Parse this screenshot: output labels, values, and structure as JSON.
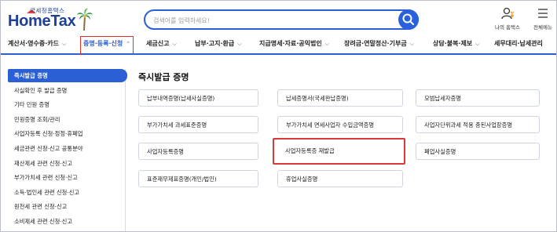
{
  "header": {
    "logo_small": "국세청홈택스",
    "logo_main": "HomeTax",
    "search_placeholder": "검색어를 입력하세요!",
    "my_hometax_label": "나의 홈택스",
    "full_menu_label": "전체메뉴"
  },
  "nav": {
    "items": [
      {
        "label": "계산서·영수증·카드",
        "active": false
      },
      {
        "label": "증명·등록·신청",
        "active": true
      },
      {
        "label": "세금신고",
        "active": false
      },
      {
        "label": "납부·고지·환급",
        "active": false
      },
      {
        "label": "지급명세·자료·공익법인",
        "active": false
      },
      {
        "label": "장려금·연말정산·기부금",
        "active": false
      },
      {
        "label": "상담·불복·제보",
        "active": false
      },
      {
        "label": "세무대리·납세관리",
        "active": false
      }
    ]
  },
  "sidebar": {
    "items": [
      {
        "label": "즉시발급 증명",
        "active": true
      },
      {
        "label": "사실확인 후 발급 증명",
        "active": false
      },
      {
        "label": "기타 민원 증명",
        "active": false
      },
      {
        "label": "민원증명 조회/관리",
        "active": false
      },
      {
        "label": "사업자등록 신청·정정·휴폐업",
        "active": false
      },
      {
        "label": "세금관련 신청·신고 공통분야",
        "active": false
      },
      {
        "label": "재산제세 관련 신청·신고",
        "active": false
      },
      {
        "label": "부가가치세 관련 신청·신고",
        "active": false
      },
      {
        "label": "소득·법인세 관련 신청·신고",
        "active": false
      },
      {
        "label": "원천세 관련 신청·신고",
        "active": false
      },
      {
        "label": "소비제세 관련 신청·신고",
        "active": false
      }
    ]
  },
  "main": {
    "title": "즉시발급 증명",
    "cards": [
      [
        "납부내역증명(납세사실증명)",
        "납세증명서(국세완납증명)",
        "모범납세자증명"
      ],
      [
        "부가가치세 과세표준증명",
        "부가가치세 면세사업자 수입금액증명",
        "사업자단위과세 적용 종된사업장증명"
      ],
      [
        "사업자등록증명",
        "사업자등록증 재발급",
        "폐업사실증명"
      ],
      [
        "표준재무제표증명(개인/법인)",
        "휴업사실증명",
        ""
      ]
    ],
    "highlighted_card": "사업자등록증 재발급"
  },
  "colors": {
    "brand_blue": "#2a5fd6",
    "highlight_red": "#d63a3a"
  }
}
